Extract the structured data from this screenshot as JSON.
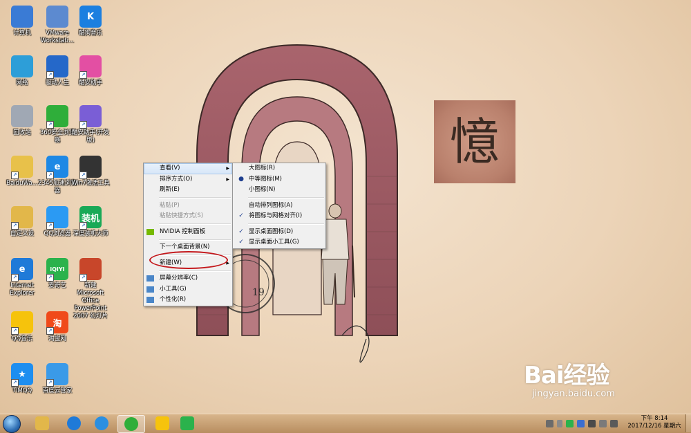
{
  "desktop_icons": [
    {
      "label": "计算机",
      "color": "#3a7bd5"
    },
    {
      "label": "VMware Workstati...",
      "color": "#5c8ad0"
    },
    {
      "label": "酷狗音乐",
      "color": "#1b7fe0",
      "glyph": "K"
    },
    {
      "label": "网络",
      "color": "#2d9ed8"
    },
    {
      "label": "驱动人生",
      "color": "#2568c9"
    },
    {
      "label": "酷安助手",
      "color": "#e34fa3"
    },
    {
      "label": "回收站",
      "color": "#a0a8b4"
    },
    {
      "label": "360安全浏览器",
      "color": "#2fae3a"
    },
    {
      "label": "酷安助手(开发版)",
      "color": "#7a5ed6"
    },
    {
      "label": "BaiduWa...",
      "color": "#e8c14a"
    },
    {
      "label": "2345加速浏览器",
      "color": "#1e88e5",
      "glyph": "e"
    },
    {
      "label": "Win7激活工具",
      "color": "#333333"
    },
    {
      "label": "自定义设",
      "color": "#e2b74a"
    },
    {
      "label": "QQ浏览器",
      "color": "#2b9af3"
    },
    {
      "label": "深度装机大师",
      "color": "#19a957",
      "glyph": "装机"
    },
    {
      "label": "Internet Explorer",
      "color": "#1f7ad8",
      "glyph": "e"
    },
    {
      "label": "爱奇艺",
      "color": "#2bb24c",
      "glyph": "iQIYI"
    },
    {
      "label": "新建 Microsoft Office PowerPoint 2007 幻灯片",
      "color": "#c8462a"
    },
    {
      "label": "QQ音乐",
      "color": "#f6c30c"
    },
    {
      "label": "淘宝网",
      "color": "#f04a1a",
      "glyph": "淘"
    },
    {
      "label": "TIMQQ",
      "color": "#1d8ef0",
      "glyph": "★"
    },
    {
      "label": "百度云管家",
      "color": "#3a9ae8"
    }
  ],
  "context_menu": {
    "items": [
      {
        "label": "查看(V)",
        "submenu": true,
        "highlight": true
      },
      {
        "label": "排序方式(O)",
        "submenu": true
      },
      {
        "label": "刷新(E)"
      },
      {
        "sep": true
      },
      {
        "label": "粘贴(P)",
        "disabled": true
      },
      {
        "label": "粘贴快捷方式(S)",
        "disabled": true
      },
      {
        "sep": true
      },
      {
        "label": "NVIDIA 控制面板",
        "icon": "nvidia-icon"
      },
      {
        "sep": true
      },
      {
        "label": "下一个桌面背景(N)"
      },
      {
        "sep": true
      },
      {
        "label": "新建(W)",
        "submenu": true
      },
      {
        "sep": true
      },
      {
        "label": "屏幕分辨率(C)",
        "icon": "screen-resolution-icon"
      },
      {
        "label": "小工具(G)",
        "icon": "gadgets-icon"
      },
      {
        "label": "个性化(R)",
        "icon": "personalize-icon"
      }
    ]
  },
  "view_submenu": {
    "items": [
      {
        "label": "大图标(R)"
      },
      {
        "label": "中等图标(M)",
        "mark": "●"
      },
      {
        "label": "小图标(N)"
      },
      {
        "sep": true
      },
      {
        "label": "自动排列图标(A)"
      },
      {
        "label": "将图标与网格对齐(I)",
        "mark": "✓"
      },
      {
        "sep": true
      },
      {
        "label": "显示桌面图标(D)",
        "mark": "✓"
      },
      {
        "label": "显示桌面小工具(G)",
        "mark": "✓"
      }
    ]
  },
  "wallpaper": {
    "seal_char": "憶",
    "stamp_text": "19"
  },
  "taskbar": {
    "items": [
      {
        "name": "explorer",
        "color": "#e2b74a"
      },
      {
        "name": "ie",
        "color": "#1f7ad8"
      },
      {
        "name": "ie2",
        "color": "#2b8fe0"
      },
      {
        "name": "360-browser",
        "color": "#2fae3a",
        "active": true
      },
      {
        "name": "qq-music",
        "color": "#f6c30c"
      },
      {
        "name": "iqiyi",
        "color": "#2bb24c"
      }
    ],
    "clock_time": "下午 8:14",
    "clock_date": "2017/12/16 星期六"
  },
  "watermark": {
    "brand": "Bai经验",
    "url": "jingyan.baidu.com"
  },
  "colors": {
    "accent": "#c4181c",
    "taskbar": "#c9a172"
  }
}
